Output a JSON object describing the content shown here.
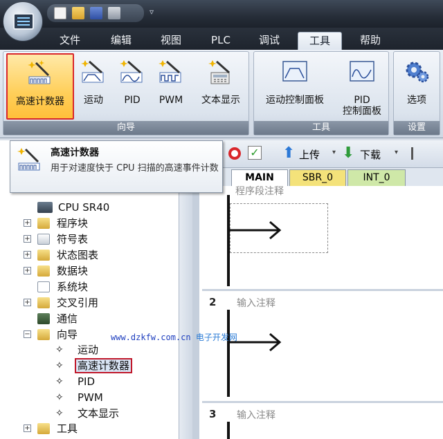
{
  "titlebar": {
    "more_glyph": "▿"
  },
  "tabs": [
    {
      "label": "文件"
    },
    {
      "label": "编辑"
    },
    {
      "label": "视图"
    },
    {
      "label": "PLC"
    },
    {
      "label": "调试"
    },
    {
      "label": "工具"
    },
    {
      "label": "帮助"
    }
  ],
  "ribbon": {
    "wizards_group": "向导",
    "tools_group": "工具",
    "settings_group": "设置",
    "buttons": {
      "hsc": "高速计数器",
      "motion": "运动",
      "pid": "PID",
      "pwm": "PWM",
      "text_display": "文本显示",
      "motion_panel": "运动控制面板",
      "pid_panel_1": "PID",
      "pid_panel_2": "控制面板",
      "options": "选项"
    }
  },
  "tooltip": {
    "title": "高速计数器",
    "text": "用于对速度快于 CPU 扫描的高速事件计数"
  },
  "tree": {
    "cpu": "CPU SR40",
    "items": [
      "程序块",
      "符号表",
      "状态图表",
      "数据块",
      "系统块",
      "交叉引用",
      "通信",
      "向导"
    ],
    "wizard_children": [
      "运动",
      "高速计数器",
      "PID",
      "PWM",
      "文本显示"
    ],
    "tools": "工具"
  },
  "watermark": {
    "url": "www.dzkfw.com.cn",
    "name": "电子开发网"
  },
  "right_toolbar": {
    "upload": "上传",
    "download": "下载"
  },
  "program_tabs": [
    "MAIN",
    "SBR_0",
    "INT_0"
  ],
  "editor": {
    "segment_comment": "程序段注释",
    "rungs": [
      {
        "number": "2",
        "comment": "输入注释"
      },
      {
        "number": "3",
        "comment": "输入注释"
      }
    ]
  }
}
